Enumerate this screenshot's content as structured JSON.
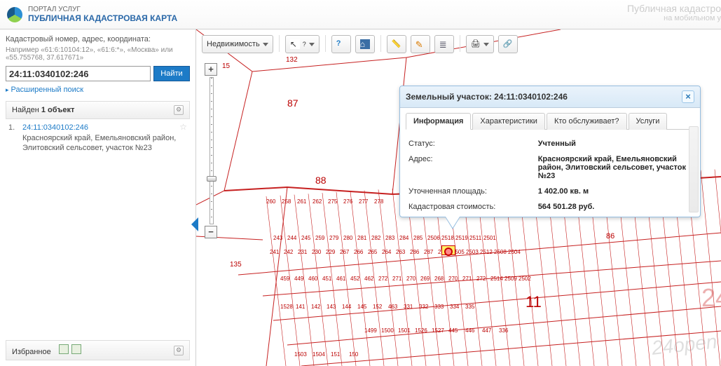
{
  "header": {
    "subtitle": "ПОРТАЛ УСЛУГ",
    "title": "ПУБЛИЧНАЯ КАДАСТРОВАЯ КАРТА",
    "right1": "Публичная кадастро",
    "right2": "на мобильном у"
  },
  "sidebar": {
    "label": "Кадастровый номер, адрес, координата:",
    "hint": "Например «61:6:10104:12», «61:6:*», «Москва» или «55.755768, 37.617671»",
    "input_value": "24:11:0340102:246",
    "find_label": "Найти",
    "adv": "Расширенный поиск",
    "found_prefix": "Найден ",
    "found_count": "1 объект",
    "result": {
      "num": "1.",
      "cn": "24:11:0340102:246",
      "addr": "Красноярский край, Емельяновский район, Элитовский сельсовет, участок №23"
    },
    "fav": "Избранное"
  },
  "toolbar": {
    "layer_select": "Недвижимость"
  },
  "popup": {
    "title_prefix": "Земельный участок: ",
    "title_cn": "24:11:0340102:246",
    "tabs": [
      "Информация",
      "Характеристики",
      "Кто обслуживает?",
      "Услуги"
    ],
    "rows": [
      {
        "k": "Статус:",
        "v": "Учтенный"
      },
      {
        "k": "Адрес:",
        "v": "Красноярский край, Емельяновский район, Элитовский сельсовет, участок №23"
      },
      {
        "k": "Уточненная площадь:",
        "v": "1 402.00 кв. м"
      },
      {
        "k": "Кадастровая стоимость:",
        "v": "564 501.28 руб."
      }
    ]
  },
  "map_labels": {
    "big": [
      "24",
      "11",
      "87",
      "88",
      "86"
    ],
    "top": [
      "15",
      "132"
    ],
    "mid": [
      "135"
    ],
    "row1": [
      "260",
      "258",
      "261",
      "262",
      "275",
      "276",
      "277",
      "278"
    ],
    "row2": [
      "243",
      "244",
      "245",
      "259",
      "279",
      "280",
      "281",
      "282",
      "283",
      "284",
      "285",
      "2506",
      "2518",
      "2519",
      "2511",
      "2501"
    ],
    "row3": [
      "241",
      "242",
      "231",
      "230",
      "229",
      "267",
      "266",
      "265",
      "264",
      "263",
      "286",
      "287",
      "288",
      "2505",
      "2503",
      "2512",
      "2508",
      "2504"
    ],
    "row4": [
      "459",
      "449",
      "460",
      "451",
      "461",
      "452",
      "462",
      "272",
      "271",
      "270",
      "269",
      "268",
      "270",
      "271",
      "272",
      "2514",
      "2509",
      "2502"
    ],
    "row5": [
      "1528",
      "141",
      "142",
      "143",
      "144",
      "145",
      "152",
      "463",
      "331",
      "332",
      "333",
      "334",
      "335"
    ],
    "row6": [
      "1499",
      "1500",
      "1501",
      "1526",
      "1527",
      "445",
      "446",
      "447",
      "336"
    ],
    "row7": [
      "1503",
      "1504",
      "151",
      "150"
    ]
  },
  "watermark": "24open"
}
